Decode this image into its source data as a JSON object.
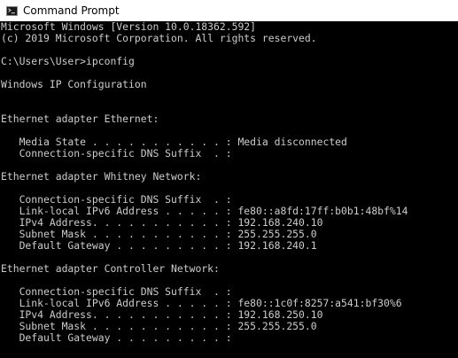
{
  "window": {
    "title": "Command Prompt",
    "icon": "cmd-icon"
  },
  "console": {
    "text_color": "#cccccc",
    "background": "#000000",
    "lines": [
      "Microsoft Windows [Version 10.0.18362.592]",
      "(c) 2019 Microsoft Corporation. All rights reserved.",
      "",
      "C:\\Users\\User>ipconfig",
      "",
      "Windows IP Configuration",
      "",
      "",
      "Ethernet adapter Ethernet:",
      "",
      "   Media State . . . . . . . . . . . : Media disconnected",
      "   Connection-specific DNS Suffix  . :",
      "",
      "Ethernet adapter Whitney Network:",
      "",
      "   Connection-specific DNS Suffix  . :",
      "   Link-local IPv6 Address . . . . . : fe80::a8fd:17ff:b0b1:48bf%14",
      "   IPv4 Address. . . . . . . . . . . : 192.168.240.10",
      "   Subnet Mask . . . . . . . . . . . : 255.255.255.0",
      "   Default Gateway . . . . . . . . . : 192.168.240.1",
      "",
      "Ethernet adapter Controller Network:",
      "",
      "   Connection-specific DNS Suffix  . :",
      "   Link-local IPv6 Address . . . . . : fe80::1c0f:8257:a541:bf30%6",
      "   IPv4 Address. . . . . . . . . . . : 192.168.250.10",
      "   Subnet Mask . . . . . . . . . . . : 255.255.255.0",
      "   Default Gateway . . . . . . . . . :"
    ]
  }
}
